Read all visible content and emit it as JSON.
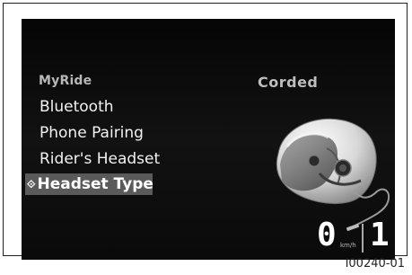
{
  "menu": {
    "category": "MyRide",
    "items": [
      {
        "label": "Bluetooth",
        "selected": false
      },
      {
        "label": "Phone Pairing",
        "selected": false
      },
      {
        "label": "Rider's Headset",
        "selected": false
      },
      {
        "label": "Headset Type",
        "selected": true
      }
    ]
  },
  "option": {
    "value": "Corded"
  },
  "status": {
    "speed": "0",
    "speed_unit": "km/h",
    "gear": "1"
  },
  "figure": {
    "id": "I00240-01"
  },
  "icons": {
    "helmet": "helmet-with-corded-headset-icon",
    "selection_cursor": "diamond-arrow-icon"
  },
  "colors": {
    "screen_background": "#0a0a0a",
    "selected_background": "#5a5a5a",
    "text": "#f2f2f2"
  }
}
